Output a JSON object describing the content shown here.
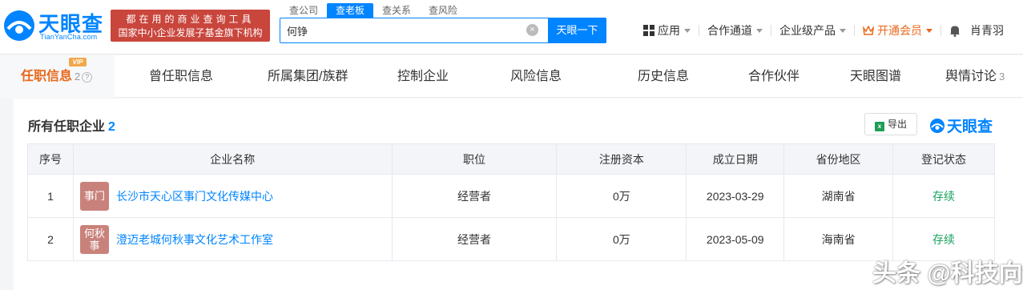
{
  "header": {
    "logo_cn": "天眼查",
    "logo_en": "TianYanCha.com",
    "slogan_line1": "都在用的商业查询工具",
    "slogan_line2": "国家中小企业发展子基金旗下机构",
    "search_tabs": [
      "查公司",
      "查老板",
      "查关系",
      "查风险"
    ],
    "active_search_tab": "查老板",
    "search_value": "何铮",
    "search_button": "天眼一下",
    "nav": {
      "apps": "应用",
      "channels": "合作通道",
      "enterprise": "企业级产品",
      "vip": "开通会员",
      "user": "肖青羽"
    }
  },
  "tabs": {
    "t0": "任职信息",
    "t0_count": "2",
    "t0_badge": "VIP",
    "t1": "曾任职信息",
    "t2": "所属集团/族群",
    "t3": "控制企业",
    "t4": "风险信息",
    "t5": "历史信息",
    "t6": "合作伙伴",
    "t7": "天眼图谱",
    "t8": "舆情讨论",
    "t8_count": "3"
  },
  "section": {
    "title": "所有任职企业",
    "count": "2",
    "export_label": "导出",
    "brand": "天眼查"
  },
  "table": {
    "headers": {
      "no": "序号",
      "name": "企业名称",
      "position": "职位",
      "capital": "注册资本",
      "date": "成立日期",
      "region": "省份地区",
      "status": "登记状态"
    },
    "rows": [
      {
        "no": "1",
        "avatar_l1": "事门",
        "avatar_l2": "",
        "name": "长沙市天心区事门文化传媒中心",
        "position": "经营者",
        "capital": "0万",
        "date": "2023-03-29",
        "region": "湖南省",
        "status": "存续"
      },
      {
        "no": "2",
        "avatar_l1": "何秋",
        "avatar_l2": "事",
        "name": "澄迈老城何秋事文化艺术工作室",
        "position": "经营者",
        "capital": "0万",
        "date": "2023-05-09",
        "region": "海南省",
        "status": "存续"
      }
    ]
  },
  "watermark": "头条 @科技向令说",
  "colors": {
    "brand_blue": "#0084ff",
    "slogan_red": "#c9463d",
    "active_tab_orange": "#e8681a",
    "status_green": "#19a15f",
    "avatar_bg": "#c9827b"
  }
}
